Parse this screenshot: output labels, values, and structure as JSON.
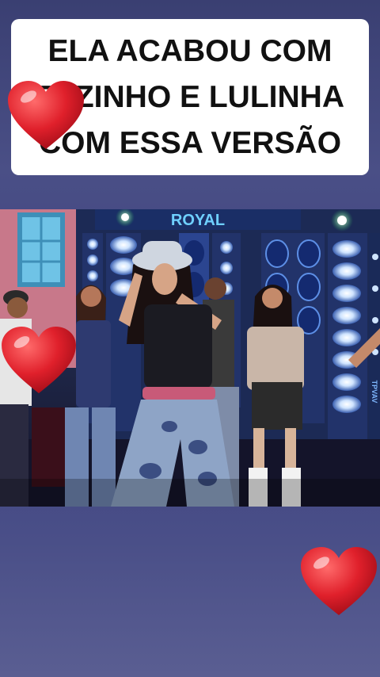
{
  "caption": {
    "lines": [
      "ELA ACABOU COM",
      "ZEZINHO E LULINHA",
      "COM ESSA VERSÃO"
    ]
  },
  "video": {
    "stage_sign": "ROYAL",
    "banner_text": "TPVAV"
  },
  "decorations": {
    "heart_color": "#e0202b",
    "icons": [
      "heart-icon",
      "heart-icon",
      "heart-icon"
    ]
  }
}
